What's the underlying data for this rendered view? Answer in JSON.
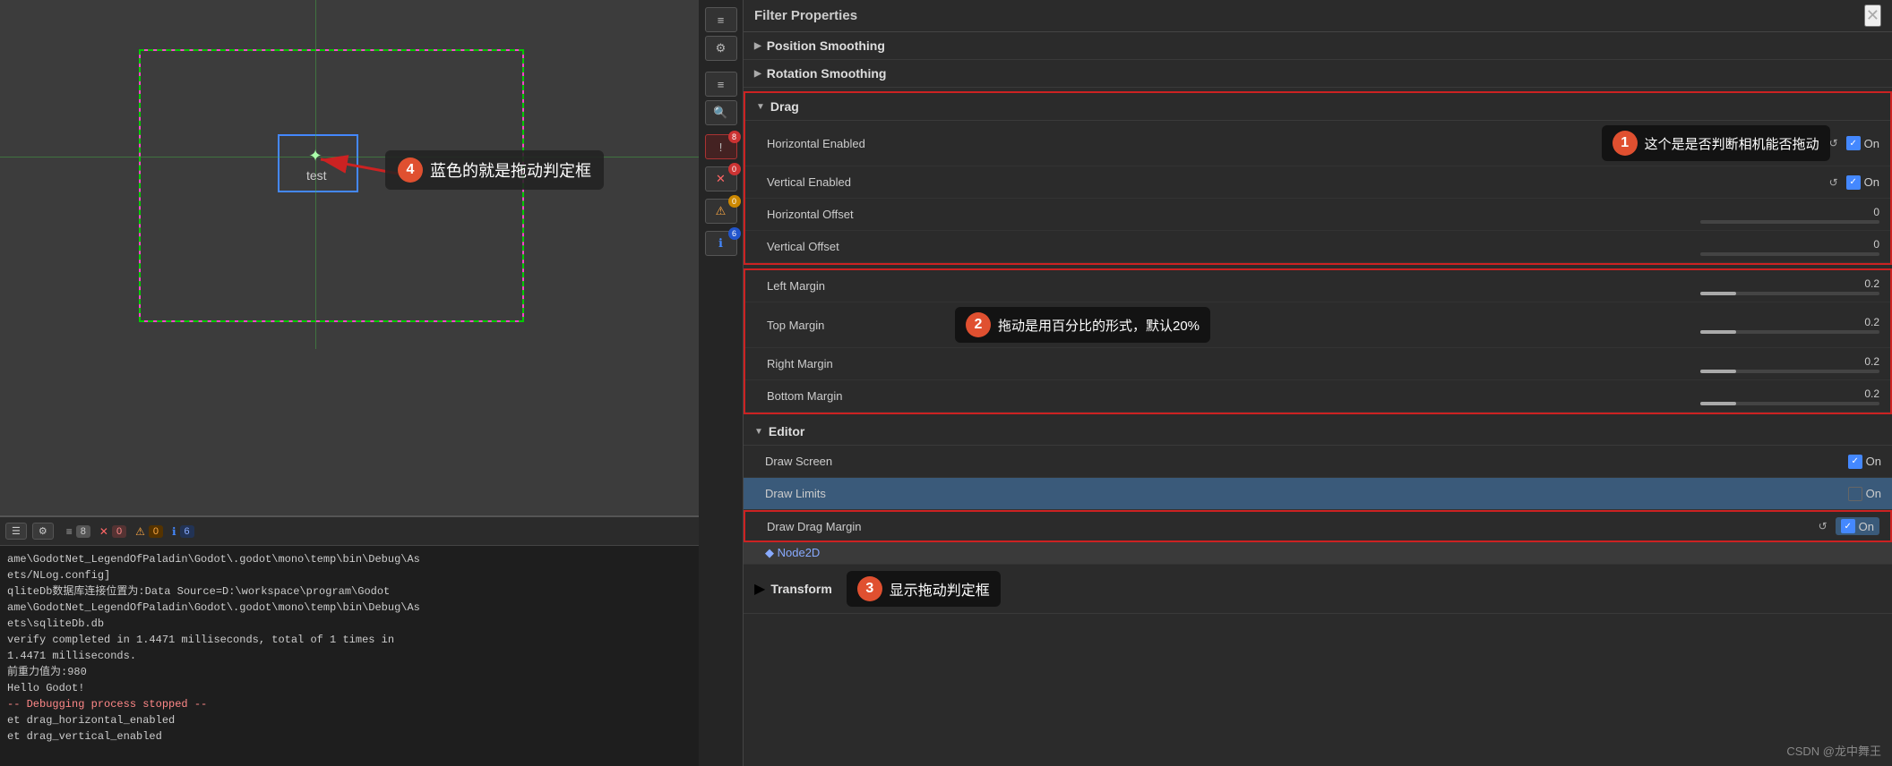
{
  "leftPanel": {
    "annotations": [
      {
        "id": "4",
        "text": "蓝色的就是拖动判定框"
      }
    ],
    "testLabel": "test"
  },
  "console": {
    "lines": [
      {
        "type": "normal",
        "text": "ame\\GodotNet_LegendOfPaladin\\Godot\\.godot\\mono\\temp\\bin\\Debug\\As"
      },
      {
        "type": "normal",
        "text": "ets/NLog.config]"
      },
      {
        "type": "normal",
        "text": "qliteDb数据库连接位置为:Data Source=D:\\workspace\\program\\Godot"
      },
      {
        "type": "normal",
        "text": "ame\\GodotNet_LegendOfPaladin\\Godot\\.godot\\mono\\temp\\bin\\Debug\\As"
      },
      {
        "type": "normal",
        "text": "ets\\sqliteDb.db"
      },
      {
        "type": "normal",
        "text": "verify completed in 1.4471 milliseconds, total of 1 times in"
      },
      {
        "type": "normal",
        "text": "1.4471 milliseconds."
      },
      {
        "type": "normal",
        "text": "前重力值为:980"
      },
      {
        "type": "normal",
        "text": "Hello Godot!"
      },
      {
        "type": "error",
        "text": "-- Debugging process stopped --"
      },
      {
        "type": "normal",
        "text": "et drag_horizontal_enabled"
      },
      {
        "type": "normal",
        "text": "et drag_vertical_enabled"
      }
    ],
    "badges": {
      "count8": "8",
      "count0_red": "0",
      "count0_yellow": "0",
      "count6": "6"
    }
  },
  "rightPanel": {
    "title": "Filter Properties",
    "sections": [
      {
        "id": "position-smoothing",
        "label": "Position Smoothing",
        "expanded": false,
        "chevron": "▶"
      },
      {
        "id": "rotation-smoothing",
        "label": "Rotation Smoothing",
        "expanded": false,
        "chevron": "▶"
      },
      {
        "id": "drag",
        "label": "Drag",
        "expanded": true,
        "chevron": "▼",
        "outlined": true,
        "rows": [
          {
            "id": "horizontal-enabled",
            "name": "Horizontal Enabled",
            "valueType": "checkbox-on",
            "value": "On"
          },
          {
            "id": "vertical-enabled",
            "name": "Vertical Enabled",
            "valueType": "checkbox-on",
            "value": "On"
          },
          {
            "id": "horizontal-offset",
            "name": "Horizontal Offset",
            "valueType": "slider",
            "value": "0",
            "fillPercent": 0
          },
          {
            "id": "vertical-offset",
            "name": "Vertical Offset",
            "valueType": "slider",
            "value": "0",
            "fillPercent": 0
          }
        ]
      },
      {
        "id": "margins",
        "label": null,
        "outlined": true,
        "rows": [
          {
            "id": "left-margin",
            "name": "Left Margin",
            "valueType": "slider",
            "value": "0.2",
            "fillPercent": 20
          },
          {
            "id": "top-margin",
            "name": "Top Margin",
            "valueType": "slider",
            "value": "0.2",
            "fillPercent": 20
          },
          {
            "id": "right-margin",
            "name": "Right Margin",
            "valueType": "slider",
            "value": "0.2",
            "fillPercent": 20
          },
          {
            "id": "bottom-margin",
            "name": "Bottom Margin",
            "valueType": "slider",
            "value": "0.2",
            "fillPercent": 20
          }
        ]
      },
      {
        "id": "editor",
        "label": "Editor",
        "expanded": true,
        "chevron": "▼",
        "rows": [
          {
            "id": "draw-screen",
            "name": "Draw Screen",
            "valueType": "checkbox-on",
            "value": "On"
          },
          {
            "id": "draw-limits",
            "name": "Draw Limits",
            "valueType": "checkbox-off",
            "value": "On",
            "highlighted": true
          },
          {
            "id": "draw-drag-margin",
            "name": "Draw Drag Margin",
            "valueType": "checkbox-on-outlined",
            "value": "On"
          }
        ]
      },
      {
        "id": "node2d",
        "label": "Node2D"
      },
      {
        "id": "transform",
        "label": "Transform",
        "annotation": "显示拖动判定框",
        "annotationId": "3"
      }
    ],
    "annotations": [
      {
        "id": "1",
        "text": "这个是是否判断相机能否拖动"
      },
      {
        "id": "2",
        "text": "拖动是用百分比的形式，默认20%"
      }
    ]
  },
  "watermark": {
    "text": "CSDN @龙中舞王"
  },
  "icons": {
    "chevronRight": "▶",
    "chevronDown": "▼",
    "close": "✕",
    "check": "✓",
    "reset": "↺"
  }
}
